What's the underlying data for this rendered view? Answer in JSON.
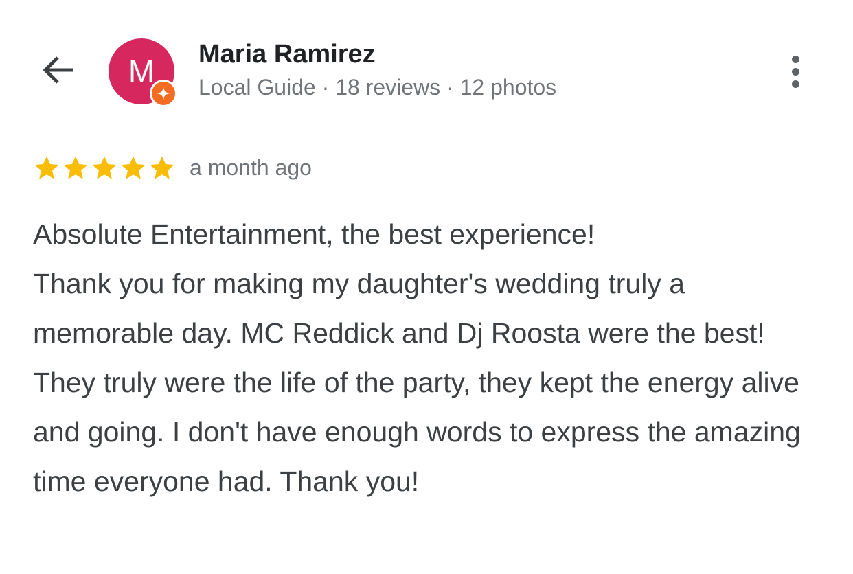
{
  "header": {
    "back_icon": "arrow-back-icon",
    "more_icon": "more-vertical-icon"
  },
  "user": {
    "avatar_letter": "M",
    "avatar_color": "#d6285f",
    "badge_icon": "local-guide-star-icon",
    "badge_color": "#f36c21",
    "name": "Maria Ramirez",
    "meta": "Local Guide · 18 reviews · 12 photos"
  },
  "review": {
    "rating": 5,
    "rating_max": 5,
    "star_color": "#fbbc04",
    "time": "a month ago",
    "text": "Absolute Entertainment, the best experience!\nThank you for making my daughter's wedding truly a memorable day. MC Reddick and Dj Roosta were the best! They truly were the life of the party, they kept the energy alive and going. I don't have enough words to express the amazing time everyone had. Thank you!"
  }
}
